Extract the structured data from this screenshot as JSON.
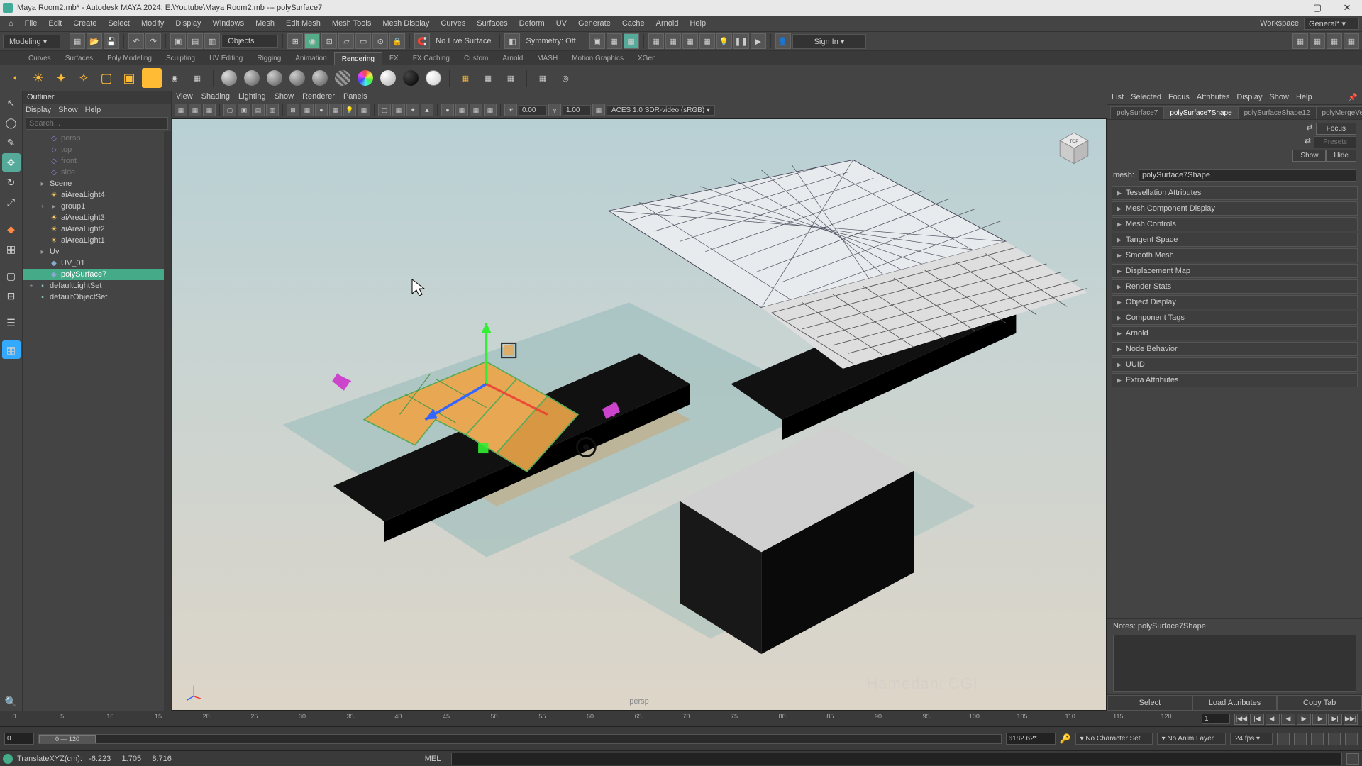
{
  "title": "Maya Room2.mb* - Autodesk MAYA 2024: E:\\Youtube\\Maya Room2.mb  ---  polySurface7",
  "menubar": [
    "File",
    "Edit",
    "Create",
    "Select",
    "Modify",
    "Display",
    "Windows",
    "Mesh",
    "Edit Mesh",
    "Mesh Tools",
    "Mesh Display",
    "Curves",
    "Surfaces",
    "Deform",
    "UV",
    "Generate",
    "Cache",
    "Arnold",
    "Help"
  ],
  "workspace_label": "Workspace:",
  "workspace_value": "General*",
  "toolbar": {
    "mode": "Modeling",
    "objects": "Objects",
    "live_surface": "No Live Surface",
    "symmetry": "Symmetry: Off",
    "sign_in": "Sign In"
  },
  "shelf_tabs": [
    "Curves",
    "Surfaces",
    "Poly Modeling",
    "Sculpting",
    "UV Editing",
    "Rigging",
    "Animation",
    "Rendering",
    "FX",
    "FX Caching",
    "Custom",
    "Arnold",
    "MASH",
    "Motion Graphics",
    "XGen"
  ],
  "shelf_active": "Rendering",
  "outliner": {
    "title": "Outliner",
    "menu": [
      "Display",
      "Show",
      "Help"
    ],
    "search_placeholder": "Search...",
    "items": [
      {
        "label": "persp",
        "icon": "cam",
        "dim": true,
        "indent": 1
      },
      {
        "label": "top",
        "icon": "cam",
        "dim": true,
        "indent": 1
      },
      {
        "label": "front",
        "icon": "cam",
        "dim": true,
        "indent": 1
      },
      {
        "label": "side",
        "icon": "cam",
        "dim": true,
        "indent": 1
      },
      {
        "label": "Scene",
        "icon": "grp",
        "dim": false,
        "indent": 0,
        "expand": "-"
      },
      {
        "label": "aiAreaLight4",
        "icon": "light",
        "dim": false,
        "indent": 1
      },
      {
        "label": "group1",
        "icon": "grp",
        "dim": false,
        "indent": 1,
        "expand": "+"
      },
      {
        "label": "aiAreaLight3",
        "icon": "light",
        "dim": false,
        "indent": 1
      },
      {
        "label": "aiAreaLight2",
        "icon": "light",
        "dim": false,
        "indent": 1
      },
      {
        "label": "aiAreaLight1",
        "icon": "light",
        "dim": false,
        "indent": 1
      },
      {
        "label": "Uv",
        "icon": "grp",
        "dim": false,
        "indent": 0,
        "expand": "-"
      },
      {
        "label": "UV_01",
        "icon": "geom",
        "dim": false,
        "indent": 1
      },
      {
        "label": "polySurface7",
        "icon": "geom",
        "dim": false,
        "indent": 1,
        "selected": true
      },
      {
        "label": "defaultLightSet",
        "icon": "set",
        "dim": false,
        "indent": 0,
        "expand": "+"
      },
      {
        "label": "defaultObjectSet",
        "icon": "set",
        "dim": false,
        "indent": 0
      }
    ]
  },
  "viewport": {
    "menu": [
      "View",
      "Shading",
      "Lighting",
      "Show",
      "Renderer",
      "Panels"
    ],
    "exposure": "0.00",
    "gamma": "1.00",
    "colorspace": "ACES 1.0 SDR-video (sRGB)",
    "persp_label": "persp",
    "watermark": "Hamedani CGI",
    "viewcube_label": "TOP"
  },
  "attr": {
    "menu": [
      "List",
      "Selected",
      "Focus",
      "Attributes",
      "Display",
      "Show",
      "Help"
    ],
    "tabs": [
      "polySurface7",
      "polySurface7Shape",
      "polySurfaceShape12",
      "polyMergeVe"
    ],
    "active_tab": 1,
    "focus": "Focus",
    "presets": "Presets",
    "show": "Show",
    "hide": "Hide",
    "mesh_label": "mesh:",
    "mesh_value": "polySurface7Shape",
    "sections": [
      "Tessellation Attributes",
      "Mesh Component Display",
      "Mesh Controls",
      "Tangent Space",
      "Smooth Mesh",
      "Displacement Map",
      "Render Stats",
      "Object Display",
      "Component Tags",
      "Arnold",
      "Node Behavior",
      "UUID",
      "Extra Attributes"
    ],
    "notes_label": "Notes: polySurface7Shape",
    "bottom": [
      "Select",
      "Load Attributes",
      "Copy Tab"
    ]
  },
  "timeslider": {
    "ticks": [
      "0",
      "5",
      "10",
      "15",
      "20",
      "25",
      "30",
      "35",
      "40",
      "45",
      "50",
      "55",
      "60",
      "65",
      "70",
      "75",
      "80",
      "85",
      "90",
      "95",
      "100",
      "105",
      "110",
      "115",
      "120"
    ],
    "current": "1"
  },
  "range": {
    "start": "0",
    "end_visible": "0 — 120",
    "value_right": "6182.62*",
    "char_set": "No Character Set",
    "anim_layer": "No Anim Layer",
    "fps": "24 fps"
  },
  "cmdline": {
    "label": "TranslateXYZ(cm):",
    "x": "-6.223",
    "y": "1.705",
    "z": "8.716",
    "mel": "MEL"
  }
}
